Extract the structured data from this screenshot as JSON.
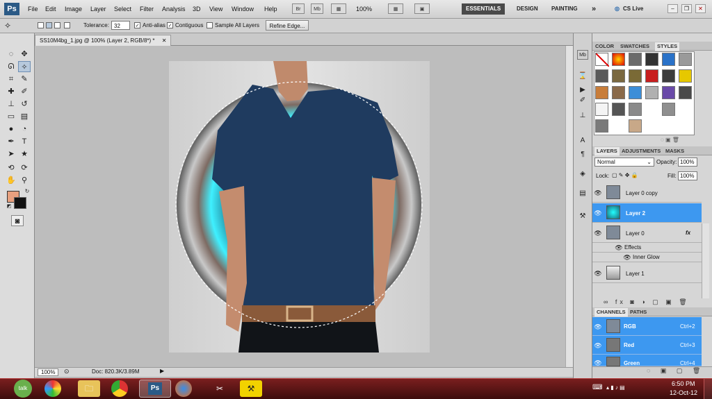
{
  "app": {
    "logo": "Ps"
  },
  "menu": [
    "File",
    "Edit",
    "Image",
    "Layer",
    "Select",
    "Filter",
    "Analysis",
    "3D",
    "View",
    "Window",
    "Help"
  ],
  "appbar": {
    "br": "Br",
    "mb": "Mb",
    "zoom": "100%"
  },
  "workspaces": {
    "essentials": "ESSENTIALS",
    "design": "DESIGN",
    "painting": "PAINTING",
    "more": "»",
    "cslive": "CS Live"
  },
  "options": {
    "tolerance_label": "Tolerance:",
    "tolerance_value": "32",
    "antialias": "Anti-alias",
    "contiguous": "Contiguous",
    "sample_all": "Sample All Layers",
    "refine_edge": "Refine Edge..."
  },
  "document": {
    "tab_title": "SS10M4bg_1.jpg @ 100% (Layer 2, RGB/8*) *",
    "zoom": "100%",
    "doc_info": "Doc: 820.3K/3.89M"
  },
  "swatches_panel": {
    "tabs": [
      "COLOR",
      "SWATCHES",
      "STYLES"
    ],
    "active": "STYLES"
  },
  "layers_panel": {
    "tabs": [
      "LAYERS",
      "ADJUSTMENTS",
      "MASKS"
    ],
    "blend_mode": "Normal",
    "opacity_label": "Opacity:",
    "opacity_value": "100%",
    "lock_label": "Lock:",
    "fill_label": "Fill:",
    "fill_value": "100%",
    "layers": [
      {
        "name": "Layer 0 copy"
      },
      {
        "name": "Layer 2"
      },
      {
        "name": "Layer 0",
        "fx": "fx"
      },
      {
        "name": "Effects"
      },
      {
        "name": "Inner Glow"
      },
      {
        "name": "Layer 1"
      }
    ]
  },
  "channels_panel": {
    "tabs": [
      "CHANNELS",
      "PATHS"
    ],
    "channels": [
      {
        "name": "RGB",
        "shortcut": "Ctrl+2"
      },
      {
        "name": "Red",
        "shortcut": "Ctrl+3"
      },
      {
        "name": "Green",
        "shortcut": "Ctrl+4"
      }
    ]
  },
  "taskbar": {
    "talk": "talk",
    "time": "6:50 PM",
    "date": "12-Oct-12"
  },
  "colors": {
    "foreground": "#e8a07f",
    "background": "#111111",
    "accent": "#3d98f0",
    "taskbar": "#5a1414"
  }
}
